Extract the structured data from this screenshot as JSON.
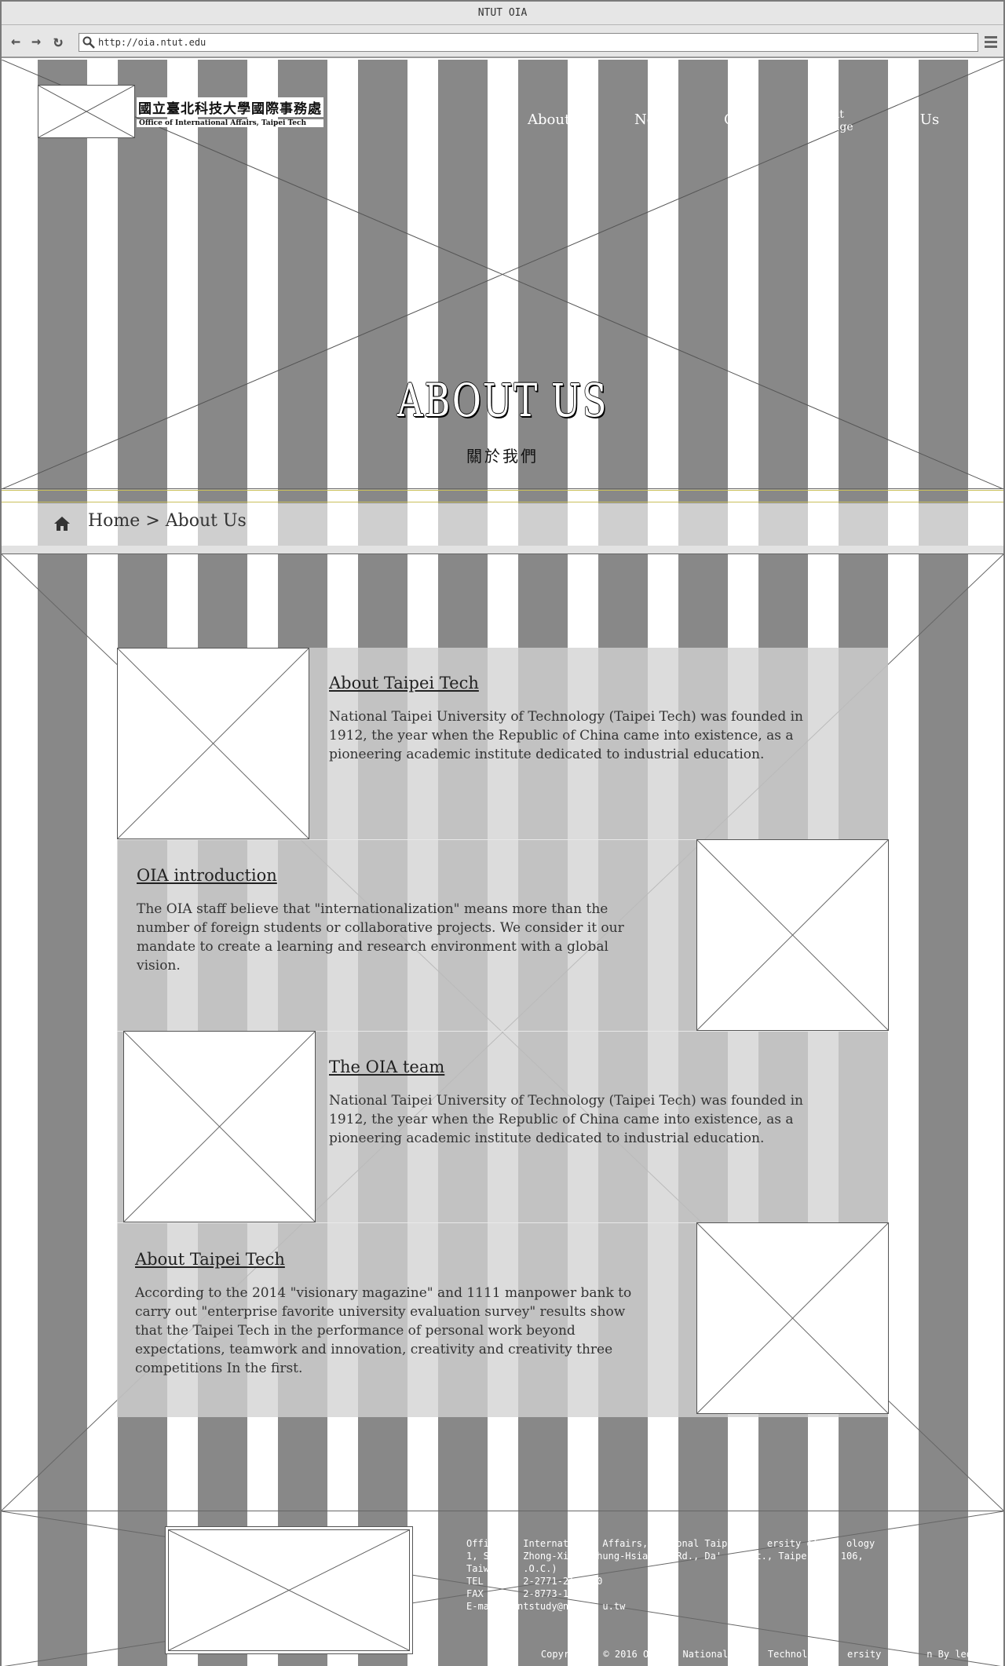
{
  "browser": {
    "title": "NTUT OIA",
    "url": "http://oia.ntut.edu"
  },
  "header": {
    "logo_cn": "國立臺北科技大學國際事務處",
    "logo_en": "Office of International Affairs, Taipei Tech",
    "nav": [
      "About",
      "Ne",
      "O",
      "ent\nange",
      "act Us"
    ]
  },
  "hero": {
    "title": "ABOUT US",
    "subtitle": "關於我們"
  },
  "breadcrumb": {
    "home": "Home",
    "separator": ">",
    "current": "About Us"
  },
  "sections": [
    {
      "title": "About Taipei Tech",
      "body": "National Taipei University of Technology (Taipei Tech) was founded in 1912, the year when the Republic of China came into existence, as a pioneering academic institute dedicated to industrial education."
    },
    {
      "title": "OIA introduction",
      "body": "The OIA staff believe that \"internationalization\" means more than the number of foreign students or collaborative projects. We consider it our mandate to create a learning and research environment with a global vision."
    },
    {
      "title": "The OIA team",
      "body": "National Taipei University of Technology (Taipei Tech) was founded in 1912, the year when the Republic of China came into existence, as a pioneering academic institute dedicated to industrial education."
    },
    {
      "title": "About Taipei Tech",
      "body": "According to the 2014 \"visionary magazine\" and 1111 manpower bank to carry out \"enterprise favorite university evaluation survey\" results show that the Taipei Tech in the performance of personal work beyond expectations, teamwork and innovation, creativity and creativity three competitions In the first."
    }
  ],
  "footer": {
    "lines": [
      "Offi      Internati     Affairs,     onal Taipei     ersity of     ology",
      "1, S      Zhong-Xi     hung-Hsia     Rd., Da'     st., Taipe    y 106,",
      "Taiw      .O.C.)",
      "TEL       2-2771-21    0",
      "FAX       2-8773-18",
      "E-ma     ntstudy@n      u.tw"
    ],
    "copyright": "Copyr      © 2016 OI     National T     Technolog     ersity -      n By leo"
  },
  "colors": {
    "stripe": "#888888",
    "panel": "#d2d2d2",
    "chrome": "#e6e6e6"
  }
}
